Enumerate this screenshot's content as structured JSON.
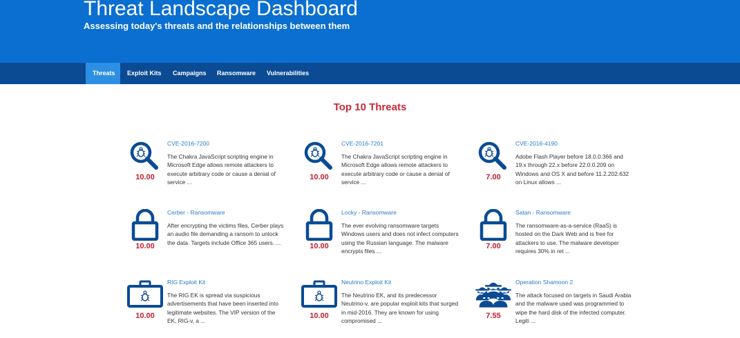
{
  "header": {
    "title": "Threat Landscape Dashboard",
    "subtitle": "Assessing today's threats and the relationships between them"
  },
  "nav": {
    "tabs": [
      {
        "label": "Threats",
        "active": true
      },
      {
        "label": "Exploit Kits",
        "active": false
      },
      {
        "label": "Campaigns",
        "active": false
      },
      {
        "label": "Ransomware",
        "active": false
      },
      {
        "label": "Vulnerabilities",
        "active": false
      }
    ]
  },
  "section_title": "Top 10 Threats",
  "colors": {
    "hero": "#0a6fd0",
    "nav": "#0a4b94",
    "active_tab": "#2d8fe3",
    "icon": "#0a4b94",
    "score": "#c01d30",
    "link": "#2a7bc4",
    "title": "#c8283a"
  },
  "threats": [
    {
      "name": "CVE-2016-7200",
      "score": "10.00",
      "icon": "magnifier-bug-icon",
      "description": "The Chakra JavaScript scripting engine in Microsoft Edge allows remote attackers to execute arbitrary code or cause a denial of service ..."
    },
    {
      "name": "CVE-2016-7201",
      "score": "10.00",
      "icon": "magnifier-bug-icon",
      "description": "The Chakra JavaScript scripting engine in Microsoft Edge allows remote attackers to execute arbitrary code or cause a denial of service ..."
    },
    {
      "name": "CVE-2016-4190",
      "score": "7.00",
      "icon": "magnifier-bug-icon",
      "description": "Adobe Flash Player before 18.0.0.366 and 19.x through 22.x before 22.0.0.209 on Windows and OS X and before 11.2.202.632 on Linux allows ..."
    },
    {
      "name": "Cerber - Ransomware",
      "score": "10.00",
      "icon": "padlock-icon",
      "description": "After encrypting the victims files, Cerber plays an audio file demanding a ransom to unlock the data. Targets include Office 365 users. ..."
    },
    {
      "name": "Locky - Ransomware",
      "score": "10.00",
      "icon": "padlock-icon",
      "description": "The ever evolving ransomware targets Windows users and does not infect computers using the Russian language. The malware encrypts files ..."
    },
    {
      "name": "Satan - Ransomware",
      "score": "7.00",
      "icon": "padlock-icon",
      "description": "The ransomware-as-a-service (RaaS) is hosted on the Dark Web and is free for attackers to use. The malware developer requires 30% in ret ..."
    },
    {
      "name": "RIG Exploit Kit",
      "score": "10.00",
      "icon": "toolkit-bug-icon",
      "description": "The RIG EK is spread via suspicious advertisements that have been inserted into legitimate websites. The VIP version of the EK, RIG-v, a ..."
    },
    {
      "name": "Neutrino Exploit Kit",
      "score": "10.00",
      "icon": "toolkit-bug-icon",
      "description": "The Neutrino EK, and its predecessor Neutrino-v, are popular exploit kits that surged in mid-2016. They are known for using compromised ..."
    },
    {
      "name": "Operation Shamoon 2",
      "score": "7.55",
      "icon": "spy-group-icon",
      "description": "The attack focused on targets in Saudi Arabia and the malware used was programmed to wipe the hard disk of the infected computer. Legiti ..."
    }
  ]
}
